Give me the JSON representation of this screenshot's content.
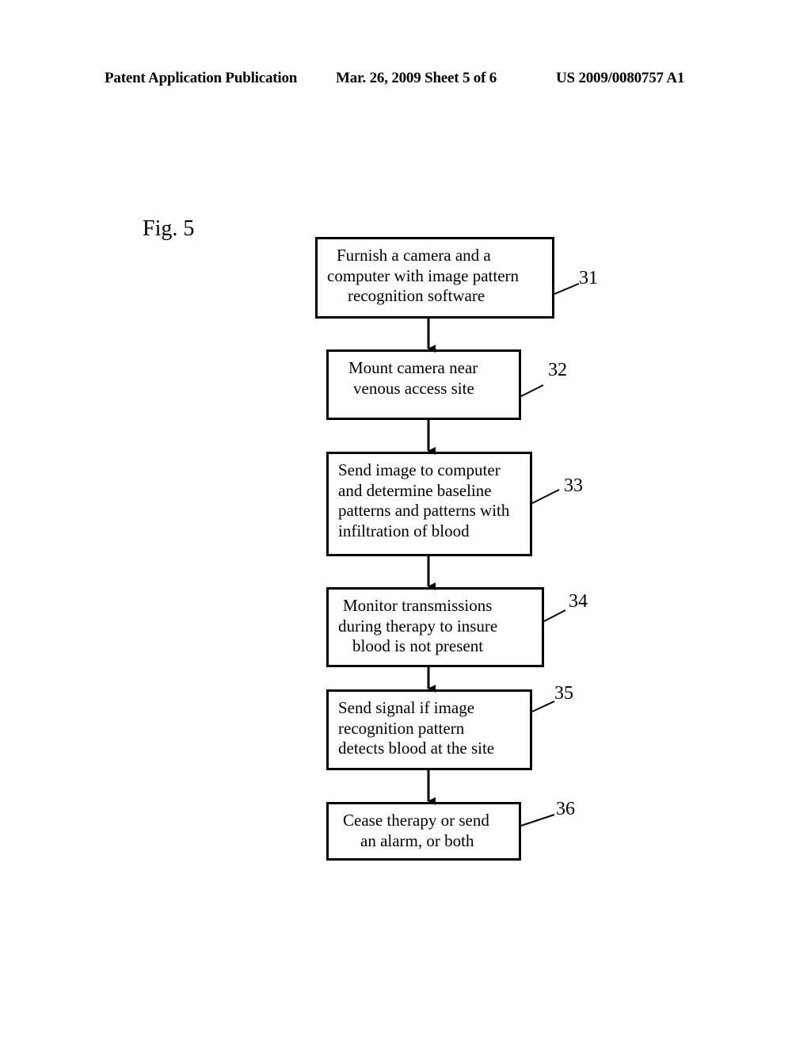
{
  "header": {
    "publication": "Patent Application Publication",
    "date_sheet": "Mar. 26, 2009  Sheet 5 of 6",
    "patent_number": "US 2009/0080757 A1"
  },
  "figure": {
    "label": "Fig. 5",
    "steps": [
      {
        "ref": "31",
        "lines": [
          "Furnish a camera and a",
          "computer with image pattern",
          "recognition software"
        ]
      },
      {
        "ref": "32",
        "lines": [
          "Mount camera near",
          "venous access site"
        ]
      },
      {
        "ref": "33",
        "lines": [
          "Send image to computer",
          "and determine baseline",
          "patterns and patterns with",
          "infiltration of blood"
        ]
      },
      {
        "ref": "34",
        "lines": [
          "Monitor transmissions",
          "during therapy to insure",
          "blood is not present"
        ]
      },
      {
        "ref": "35",
        "lines": [
          "Send signal if image",
          "recognition pattern",
          "detects blood at the site"
        ]
      },
      {
        "ref": "36",
        "lines": [
          "Cease therapy or send",
          "an alarm, or both"
        ]
      }
    ]
  }
}
